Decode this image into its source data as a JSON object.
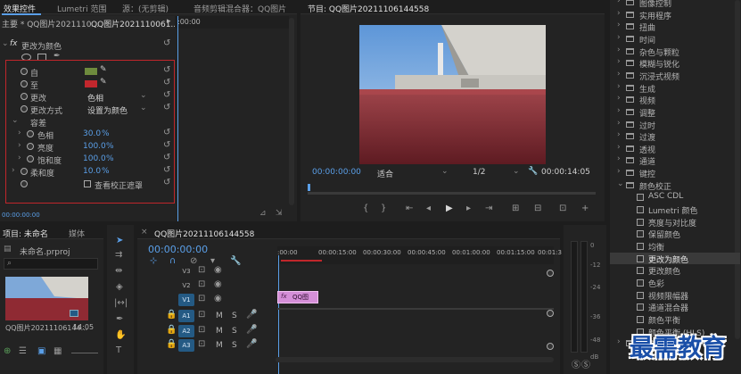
{
  "effect_controls": {
    "tabs": [
      "效果控件",
      "Lumetri 范围",
      "源：(无剪辑)",
      "音频剪辑混合器：QQ图片"
    ],
    "clip_header": "主要 * QQ图片2021110...",
    "clip_link": "QQ图片2021110061...",
    "ruler_time": ":00:00",
    "fx_name": "更改为颜色",
    "from_label": "自",
    "to_label": "至",
    "change_label": "更改",
    "change_value": "色相",
    "change_method_label": "更改方式",
    "change_method_value": "设置为颜色",
    "tolerance_label": "容差",
    "hue_label": "色相",
    "hue_value": "30.0",
    "lightness_label": "亮度",
    "lightness_value": "100.0",
    "saturation_label": "饱和度",
    "saturation_value": "100.0",
    "softness_label": "柔和度",
    "softness_value": "10.0",
    "pct": "%",
    "view_mask_label": "查看校正遮罩",
    "timecode": "00:00:00:00",
    "from_color": "#6e8b3d",
    "to_color": "#c2272d"
  },
  "program": {
    "title": "节目: QQ图片20211106144558",
    "timecode": "00:00:00:00",
    "fit": "适合",
    "ratio": "1/2",
    "duration": "00:00:14:05"
  },
  "project": {
    "tabs": [
      "项目: 未命名",
      "媒体"
    ],
    "file": "未命名.prproj",
    "clip_name": "QQ图片20211106144...",
    "clip_duration": "14:05"
  },
  "timeline": {
    "title": "QQ图片20211106144558",
    "timecode": "00:00:00:00",
    "ruler": [
      ":00:00",
      "00:00:15:00",
      "00:00:30:00",
      "00:00:45:00",
      "00:01:00:00",
      "00:01:15:00",
      "00:01:3"
    ],
    "tracks_video": [
      "V3",
      "V2",
      "V1"
    ],
    "tracks_audio": [
      "A1",
      "A2",
      "A3"
    ],
    "clip_label": "QQ图",
    "fx_badge": "fx",
    "m": "M",
    "s": "S"
  },
  "meter": {
    "ticks": [
      "0",
      "-12",
      "-24",
      "-36",
      "-48",
      "dB"
    ]
  },
  "effects_tree": {
    "items_top": [
      "图像控制",
      "实用程序",
      "扭曲",
      "时间",
      "杂色与颗粒",
      "模糊与锐化",
      "沉浸式视频",
      "生成",
      "视频",
      "调整",
      "过时",
      "过渡",
      "透视",
      "通道",
      "键控",
      "颜色校正"
    ],
    "color_effects": [
      "ASC CDL",
      "Lumetri 颜色",
      "亮度与对比度",
      "保留颜色",
      "均衡",
      "更改为颜色",
      "更改颜色",
      "色彩",
      "视频限幅器",
      "通道混合器",
      "颜色平衡",
      "颜色平衡 (HLS)"
    ],
    "items_bottom": [
      "风格化"
    ],
    "selected": "更改为颜色"
  },
  "watermark": "最需教育"
}
